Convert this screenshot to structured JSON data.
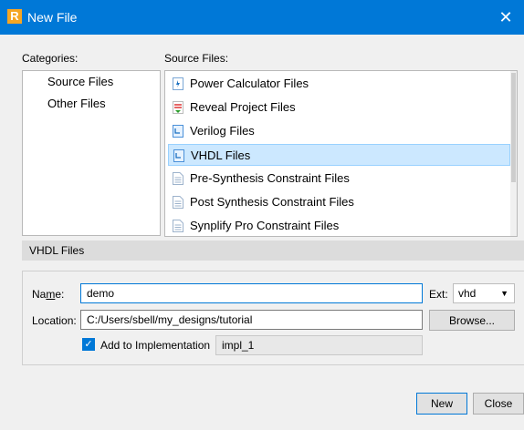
{
  "window": {
    "title": "New File",
    "app_icon_letter": "R",
    "close_glyph": "✕"
  },
  "categories": {
    "label": "Categories:",
    "items": [
      "Source Files",
      "Other Files"
    ],
    "selected_index": 0
  },
  "source_files": {
    "label": "Source Files:",
    "items": [
      {
        "label": "Power Calculator Files",
        "icon": "power-calculator-icon"
      },
      {
        "label": "Reveal Project Files",
        "icon": "reveal-project-icon"
      },
      {
        "label": "Verilog Files",
        "icon": "verilog-file-icon"
      },
      {
        "label": "VHDL Files",
        "icon": "vhdl-file-icon"
      },
      {
        "label": "Pre-Synthesis Constraint Files",
        "icon": "document-icon"
      },
      {
        "label": "Post Synthesis Constraint Files",
        "icon": "document-icon"
      },
      {
        "label": "Synplify Pro Constraint Files",
        "icon": "document-icon"
      }
    ],
    "selected_index": 3
  },
  "details": {
    "header": "VHDL Files",
    "name_label": "Name:",
    "name_value": "demo",
    "ext_label": "Ext:",
    "ext_value": "vhd",
    "location_label": "Location:",
    "location_value": "C:/Users/sbell/my_designs/tutorial",
    "browse_label": "Browse...",
    "add_to_impl_label": "Add to Implementation",
    "add_to_impl_checked": true,
    "implementation_value": "impl_1"
  },
  "buttons": {
    "new_label": "New",
    "close_label": "Close"
  },
  "colors": {
    "titlebar": "#0078d7",
    "selection": "#cce8ff",
    "accent": "#0078d7"
  }
}
